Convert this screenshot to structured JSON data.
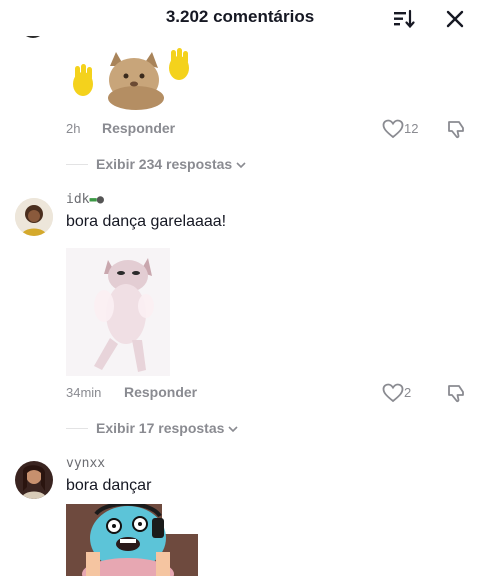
{
  "header": {
    "title": "3.202 comentários",
    "sort_icon": "sort-icon",
    "close_icon": "close-icon"
  },
  "comments": [
    {
      "media": "cat-dancing-gif",
      "time": "2h",
      "reply_label": "Responder",
      "likes": "12",
      "view_replies": "Exibir 234 respostas"
    },
    {
      "username": "idk",
      "username_emojis": [
        "money-emoji",
        "ninja-emoji"
      ],
      "text": "bora dança garelaaaa!",
      "media": "cat-dancing-gif",
      "time": "34min",
      "reply_label": "Responder",
      "likes": "2",
      "view_replies": "Exibir 17 respostas"
    },
    {
      "username": "vynxx",
      "text": "bora dançar",
      "media": "cartoon-gif"
    }
  ],
  "colors": {
    "primary_text": "#161823",
    "secondary_text": "#8a8b91",
    "background": "#ffffff"
  }
}
